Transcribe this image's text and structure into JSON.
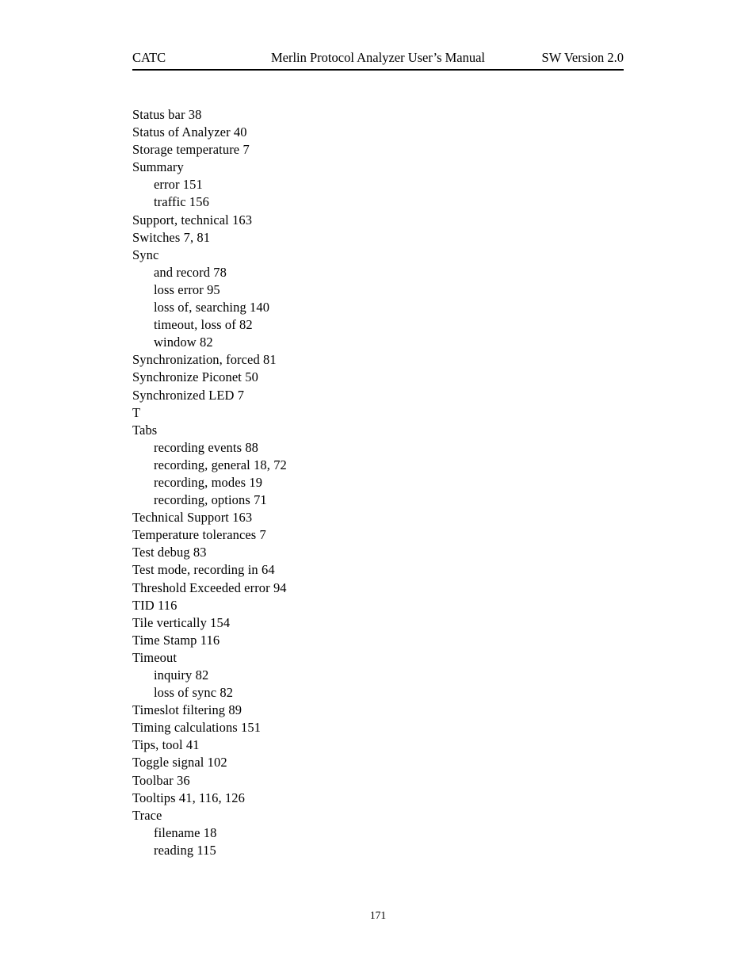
{
  "header": {
    "left": "CATC",
    "center": "Merlin Protocol Analyzer User’s Manual",
    "right": "SW Version 2.0"
  },
  "footer": {
    "page_number": "171"
  },
  "index": {
    "entries": [
      {
        "text": "Status bar 38",
        "level": 0
      },
      {
        "text": "Status of Analyzer 40",
        "level": 0
      },
      {
        "text": "Storage temperature 7",
        "level": 0
      },
      {
        "text": "Summary",
        "level": 0
      },
      {
        "text": "error 151",
        "level": 1
      },
      {
        "text": "traffic 156",
        "level": 1
      },
      {
        "text": "Support, technical 163",
        "level": 0
      },
      {
        "text": "Switches 7, 81",
        "level": 0
      },
      {
        "text": "Sync",
        "level": 0
      },
      {
        "text": "and record 78",
        "level": 1
      },
      {
        "text": "loss error 95",
        "level": 1
      },
      {
        "text": "loss of, searching 140",
        "level": 1
      },
      {
        "text": "timeout, loss of 82",
        "level": 1
      },
      {
        "text": "window 82",
        "level": 1
      },
      {
        "text": "Synchronization, forced 81",
        "level": 0
      },
      {
        "text": "Synchronize Piconet 50",
        "level": 0
      },
      {
        "text": "Synchronized LED 7",
        "level": 0
      },
      {
        "text": "T",
        "level": 0,
        "section_letter": true
      },
      {
        "text": "Tabs",
        "level": 0
      },
      {
        "text": "recording events 88",
        "level": 1
      },
      {
        "text": "recording, general 18, 72",
        "level": 1
      },
      {
        "text": "recording, modes 19",
        "level": 1
      },
      {
        "text": "recording, options 71",
        "level": 1
      },
      {
        "text": "Technical Support 163",
        "level": 0
      },
      {
        "text": "Temperature tolerances 7",
        "level": 0
      },
      {
        "text": "Test debug 83",
        "level": 0
      },
      {
        "text": "Test mode, recording in 64",
        "level": 0
      },
      {
        "text": "Threshold Exceeded error 94",
        "level": 0
      },
      {
        "text": "TID 116",
        "level": 0
      },
      {
        "text": "Tile vertically 154",
        "level": 0
      },
      {
        "text": "Time Stamp 116",
        "level": 0
      },
      {
        "text": "Timeout",
        "level": 0
      },
      {
        "text": "inquiry 82",
        "level": 1
      },
      {
        "text": "loss of sync 82",
        "level": 1
      },
      {
        "text": "Timeslot filtering 89",
        "level": 0
      },
      {
        "text": "Timing calculations 151",
        "level": 0
      },
      {
        "text": "Tips, tool 41",
        "level": 0
      },
      {
        "text": "Toggle signal 102",
        "level": 0
      },
      {
        "text": "Toolbar 36",
        "level": 0
      },
      {
        "text": "Tooltips 41, 116, 126",
        "level": 0
      },
      {
        "text": "Trace",
        "level": 0
      },
      {
        "text": "filename 18",
        "level": 1
      },
      {
        "text": "reading 115",
        "level": 1
      }
    ]
  }
}
